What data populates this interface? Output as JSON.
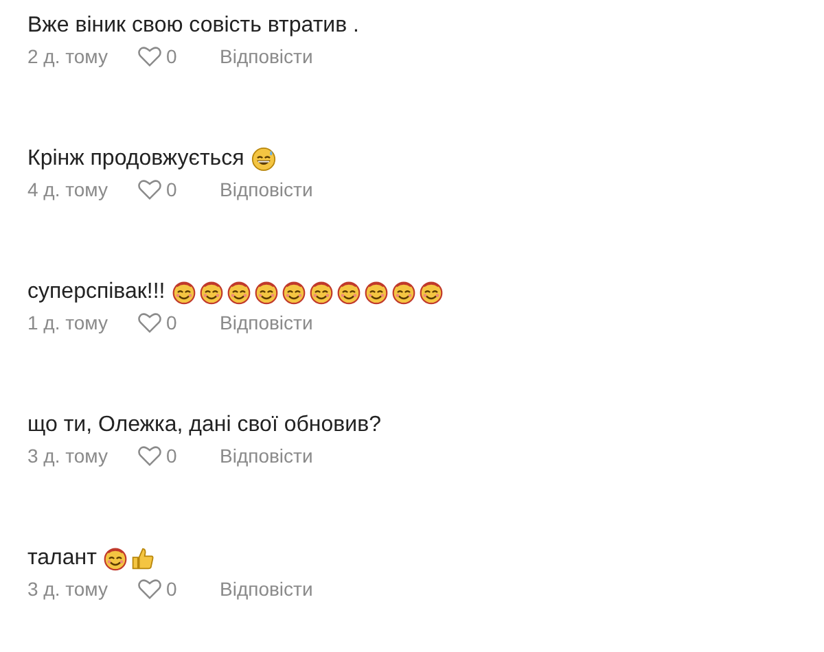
{
  "comments": [
    {
      "text": "Вже віник свою совість втратив .",
      "time": "2 д. тому",
      "likes": "0",
      "reply": "Відповісти"
    },
    {
      "text": "Крінж продовжується",
      "emoji": [
        {
          "kind": "grin-sweat"
        }
      ],
      "time": "4 д. тому",
      "likes": "0",
      "reply": "Відповісти"
    },
    {
      "text": "суперспівак!!!",
      "emoji": [
        {
          "kind": "smiling-face"
        },
        {
          "kind": "smiling-face"
        },
        {
          "kind": "smiling-face"
        },
        {
          "kind": "smiling-face"
        },
        {
          "kind": "smiling-face"
        },
        {
          "kind": "smiling-face"
        },
        {
          "kind": "smiling-face"
        },
        {
          "kind": "smiling-face"
        },
        {
          "kind": "smiling-face"
        },
        {
          "kind": "smiling-face"
        }
      ],
      "time": "1 д. тому",
      "likes": "0",
      "reply": "Відповісти"
    },
    {
      "text": "що ти, Олежка, дані свої обновив?",
      "time": "3 д. тому",
      "likes": "0",
      "reply": "Відповісти"
    },
    {
      "text": "талант",
      "emoji": [
        {
          "kind": "smiling-face"
        },
        {
          "kind": "thumbs-up"
        }
      ],
      "time": "3 д. тому",
      "likes": "0",
      "reply": "Відповісти"
    }
  ]
}
